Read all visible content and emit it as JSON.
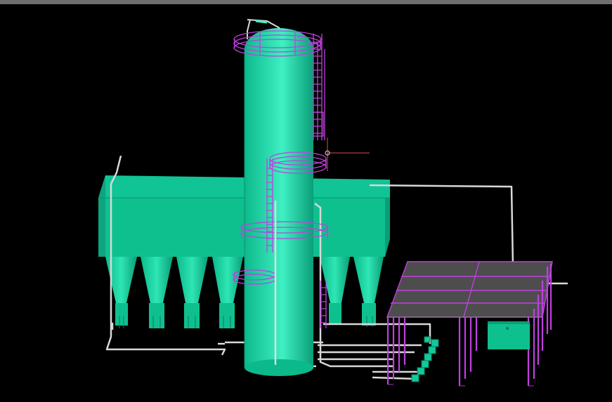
{
  "viewport": {
    "background": "#000000",
    "frame_color": "#6e6e6e"
  },
  "colors": {
    "equipment": "#12c99a",
    "equipment_shadow": "#0a9e78",
    "equipment_highlight": "#3ff0c2",
    "structure": "#c040e0",
    "piping": "#d8d8d8",
    "platform": "#4d4d4d",
    "cursor": "#e04a5a"
  },
  "icons": [
    "crosshair-cursor-icon"
  ]
}
